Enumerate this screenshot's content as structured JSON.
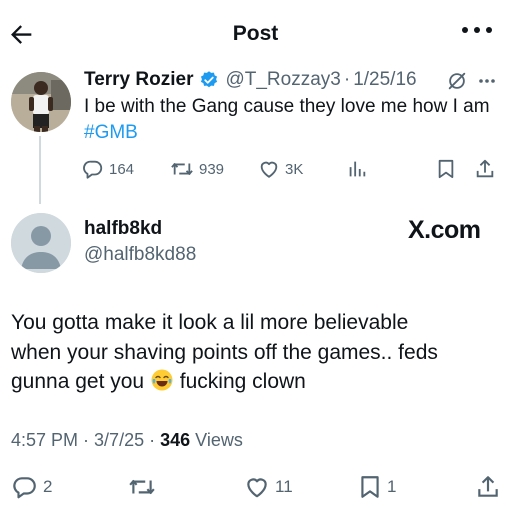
{
  "header": {
    "title": "Post"
  },
  "parent_post": {
    "author_name": "Terry Rozier",
    "author_handle": "@T_Rozzay3",
    "separator": "·",
    "date": "1/25/16",
    "text": "I be with the Gang cause they love me how I am ",
    "hashtag": "#GMB",
    "actions": {
      "replies": "164",
      "reposts": "939",
      "likes": "3K"
    }
  },
  "main_post": {
    "author_name": "halfb8kd",
    "author_handle": "@halfb8kd88",
    "watermark": "X.com",
    "text_line1": "You gotta make it look a lil more believable",
    "text_line2": "when your shaving points off the games.. feds",
    "text_line3_a": "gunna get you ",
    "text_line3_b": " fucking clown",
    "time": "4:57 PM",
    "date": "3/7/25",
    "separator": " · ",
    "views_count": "346",
    "views_label": " Views",
    "actions": {
      "replies": "2",
      "reposts": "",
      "likes": "11",
      "bookmarks": "1"
    }
  },
  "icons": {
    "back": "arrow-left-icon",
    "more": "more-horizontal-icon",
    "verified": "verified-badge-icon",
    "grok": "grok-icon",
    "reply": "reply-bubble-icon",
    "repost": "repost-icon",
    "like": "heart-icon",
    "views": "analytics-bars-icon",
    "bookmark": "bookmark-icon",
    "share": "share-icon",
    "emoji": "face-with-tears-of-joy-emoji"
  },
  "colors": {
    "link": "#1d9bf0",
    "muted": "#536471",
    "text": "#0f1419",
    "divider": "#cfd9de"
  }
}
